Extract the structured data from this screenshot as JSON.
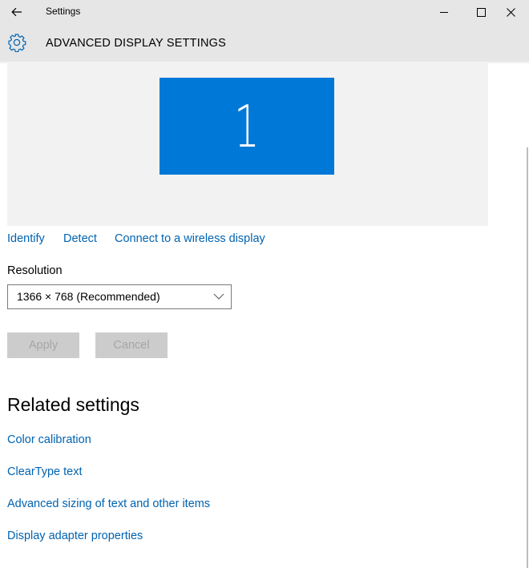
{
  "window": {
    "app_title": "Settings",
    "back_icon": "arrow-left-icon",
    "minimize_icon": "minimize-icon",
    "maximize_icon": "maximize-icon",
    "close_icon": "close-icon"
  },
  "header": {
    "icon": "gear-icon",
    "title": "ADVANCED DISPLAY SETTINGS"
  },
  "display_preview": {
    "monitor_number": "1",
    "accent_color": "#0078d7"
  },
  "display_links": [
    "Identify",
    "Detect",
    "Connect to a wireless display"
  ],
  "resolution": {
    "label": "Resolution",
    "selected": "1366 × 768 (Recommended)"
  },
  "buttons": {
    "apply": "Apply",
    "cancel": "Cancel"
  },
  "related": {
    "title": "Related settings",
    "links": [
      "Color calibration",
      "ClearType text",
      "Advanced sizing of text and other items",
      "Display adapter properties"
    ]
  },
  "colors": {
    "link": "#0063b1",
    "titlebar": "#e6e6e6"
  }
}
